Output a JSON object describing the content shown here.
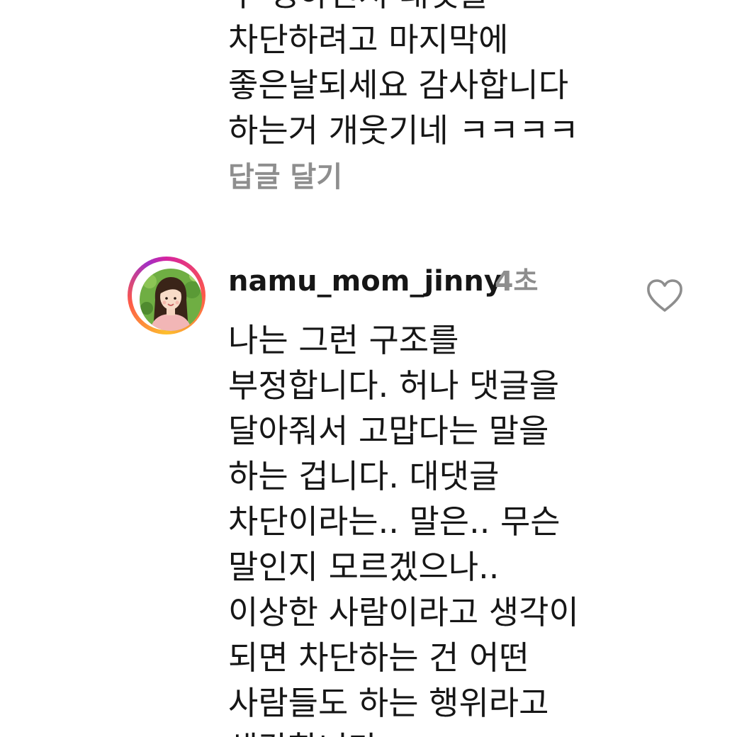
{
  "previous_comment": {
    "lines": [
      "무 생하면서 대댓을",
      "차단하려고 마지막에",
      "좋은날되세요 감사합니다",
      "하는거 개웃기네 ㅋㅋㅋㅋ"
    ],
    "reply_label": "답글 달기"
  },
  "comment": {
    "username": "namu_mom_jinny",
    "timestamp": "4초",
    "like_icon": "heart-outline-icon",
    "avatar_icon": "profile-avatar",
    "lines": [
      "나는 그런 구조를",
      "부정합니다. 허나 댓글을",
      "달아줘서 고맙다는 말을",
      "하는 겁니다. 대댓글",
      "차단이라는..  말은.. 무슨",
      "말인지 모르겠으나..",
      "이상한 사람이라고 생각이",
      "되면 차단하는 건 어떤",
      "사람들도 하는 행위라고",
      "생각합니다."
    ]
  },
  "colors": {
    "text": "#161616",
    "muted": "#8e8e8e",
    "story_ring_start": "#d6249f",
    "story_ring_mid": "#fd5949",
    "story_ring_end": "#fdbf2d"
  }
}
